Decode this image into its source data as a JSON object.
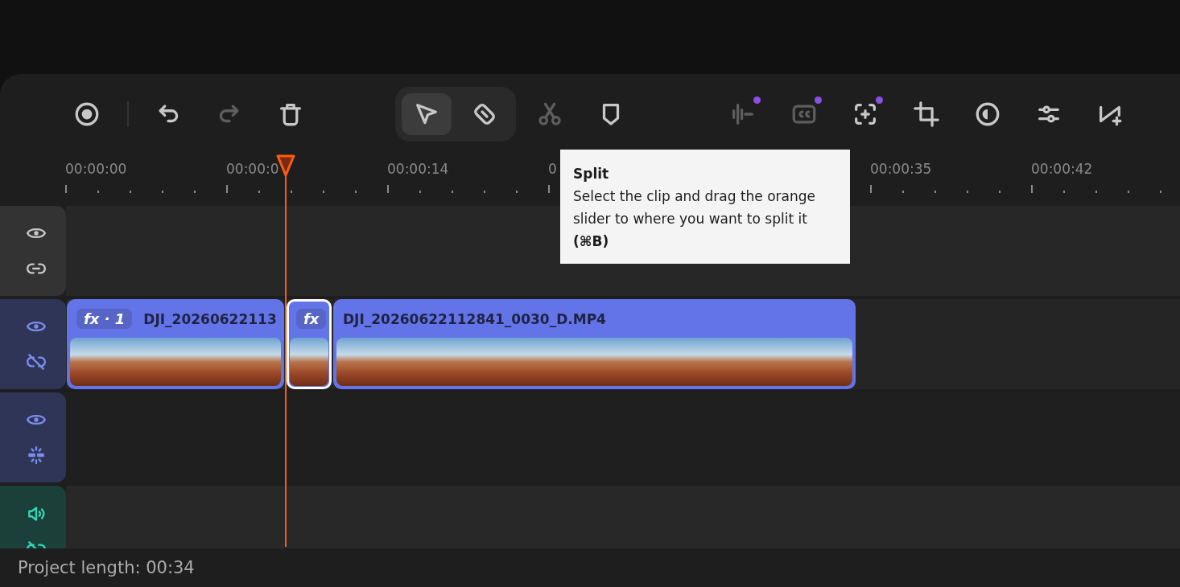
{
  "toolbar": {
    "history_tools": [
      {
        "kind": "record",
        "disabled": false
      },
      {
        "kind": "undo",
        "disabled": false
      },
      {
        "kind": "redo",
        "disabled": true
      },
      {
        "kind": "delete",
        "disabled": false
      }
    ],
    "mode_tools": [
      {
        "kind": "select",
        "selected": true
      },
      {
        "kind": "ripple",
        "selected": false
      }
    ],
    "edit_tools": [
      {
        "kind": "split",
        "disabled": true
      },
      {
        "kind": "marker",
        "disabled": false
      }
    ],
    "clip_tools": [
      {
        "kind": "audio",
        "disabled": true,
        "badge": true
      },
      {
        "kind": "captions",
        "disabled": true,
        "badge": true
      },
      {
        "kind": "focus",
        "disabled": false,
        "badge": true
      },
      {
        "kind": "crop",
        "disabled": false
      },
      {
        "kind": "color",
        "disabled": false
      },
      {
        "kind": "adjust",
        "disabled": false
      },
      {
        "kind": "transition",
        "disabled": false
      }
    ]
  },
  "ruler": {
    "labels": [
      "00:00:00",
      "00:00:0",
      "00:00:14",
      "0",
      "00:00:35",
      "00:00:42"
    ]
  },
  "tooltip": {
    "title": "Split",
    "text": "Select the clip and drag the orange slider to where you want to split it",
    "shortcut": "(⌘B)"
  },
  "tracks": [
    {
      "kind": "overlay",
      "linked": true
    },
    {
      "kind": "video",
      "linked": false,
      "clips": [
        {
          "badge": "fx · 1",
          "name": "DJI_20260622113",
          "selected": false
        },
        {
          "badge": "fx",
          "selected": true
        },
        {
          "name": "DJI_20260622112841_0030_D.MP4",
          "selected": false
        }
      ]
    },
    {
      "kind": "effect"
    },
    {
      "kind": "audio",
      "linked": false
    }
  ],
  "status_bar": {
    "text": "Project length: 00:34"
  }
}
